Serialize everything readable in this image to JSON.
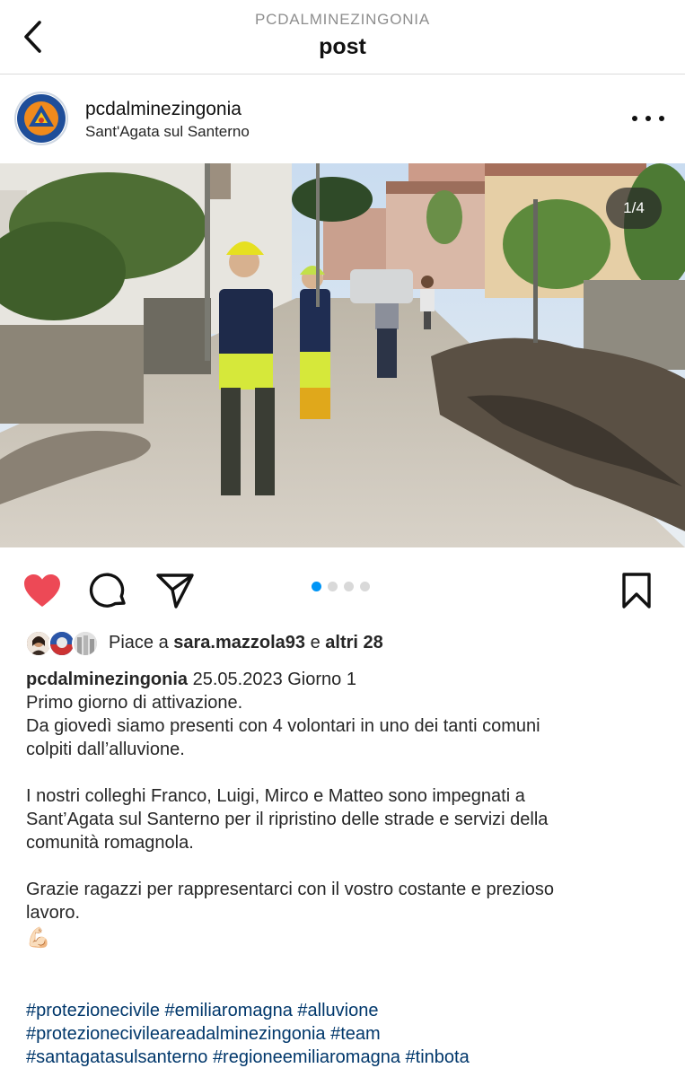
{
  "header": {
    "username": "PCDALMINEZINGONIA",
    "title": "post"
  },
  "post": {
    "author": "pcdalminezingonia",
    "location": "Sant'Agata sul Santerno",
    "image_counter": "1/4",
    "carousel": {
      "count": 4,
      "active": 1
    }
  },
  "likes": {
    "prefix": "Piace a ",
    "user": "sara.mazzola93",
    "middle": " e ",
    "others": "altri 28"
  },
  "caption": {
    "author": "pcdalminezingonia",
    "first_line": " 25.05.2023 Giorno 1",
    "lines": [
      "Primo giorno di attivazione.",
      "Da giovedì siamo presenti con 4 volontari in uno dei tanti comuni",
      "colpiti dall’alluvione.",
      "",
      "I nostri colleghi Franco, Luigi, Mirco e Matteo sono impegnati a",
      "Sant’Agata sul Santerno per il ripristino delle strade e servizi della",
      "comunità romagnola.",
      "",
      "Grazie ragazzi per rappresentarci con il vostro costante e prezioso",
      "lavoro."
    ],
    "emoji": "💪🏻",
    "hashtags": [
      [
        "#protezionecivile",
        "#emiliaromagna",
        "#alluvione"
      ],
      [
        "#protezionecivileareadalminezingonia",
        "#team"
      ],
      [
        "#santagatasulsanterno",
        "#regioneemiliaromagna",
        "#tinbota"
      ]
    ]
  },
  "icons": {
    "back": "chevron-left-icon",
    "more": "more-horizontal-icon",
    "like": "heart-filled-icon",
    "comment": "comment-icon",
    "share": "send-icon",
    "save": "bookmark-icon"
  },
  "colors": {
    "like": "#ed4956",
    "link": "#00376b",
    "active_dot": "#0095f6",
    "logo_blue": "#1f4e99",
    "logo_orange": "#f08a1c"
  }
}
